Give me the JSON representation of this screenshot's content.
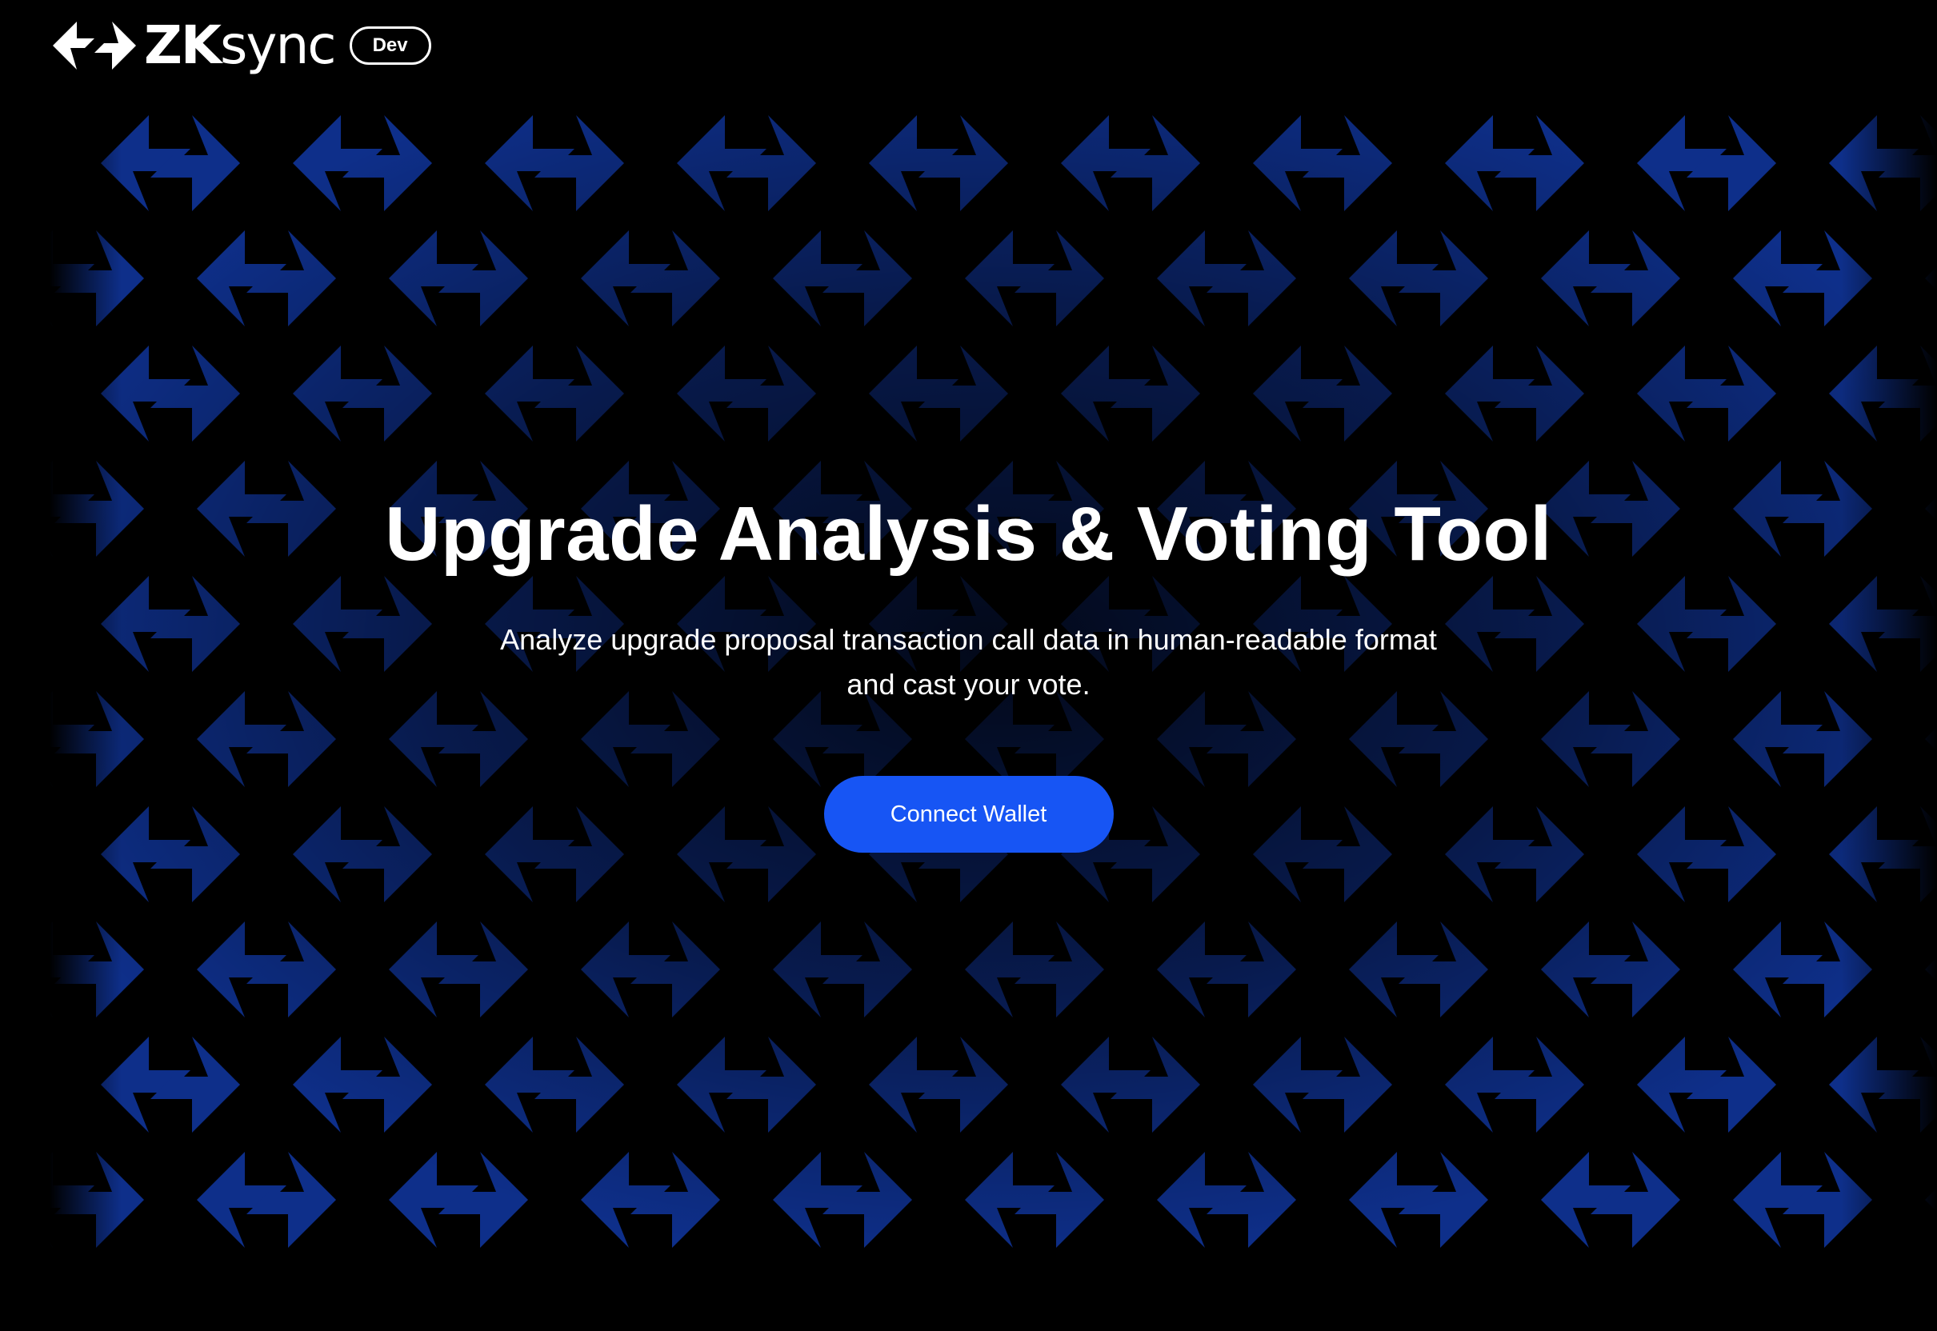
{
  "header": {
    "brand_bold": "ZK",
    "brand_light": "sync",
    "env_badge": "Dev",
    "logo_icon": "zksync-double-arrow-icon"
  },
  "hero": {
    "title": "Upgrade Analysis & Voting Tool",
    "subtitle": "Analyze upgrade proposal transaction call data in human-readable format and cast your vote.",
    "connect_button_label": "Connect Wallet"
  },
  "background": {
    "pattern_icon": "arrow-pattern-icon",
    "colors": {
      "page": "#000000",
      "arrow_blue": "#0e2f8a",
      "button": "#1755f4",
      "text": "#ffffff"
    }
  }
}
